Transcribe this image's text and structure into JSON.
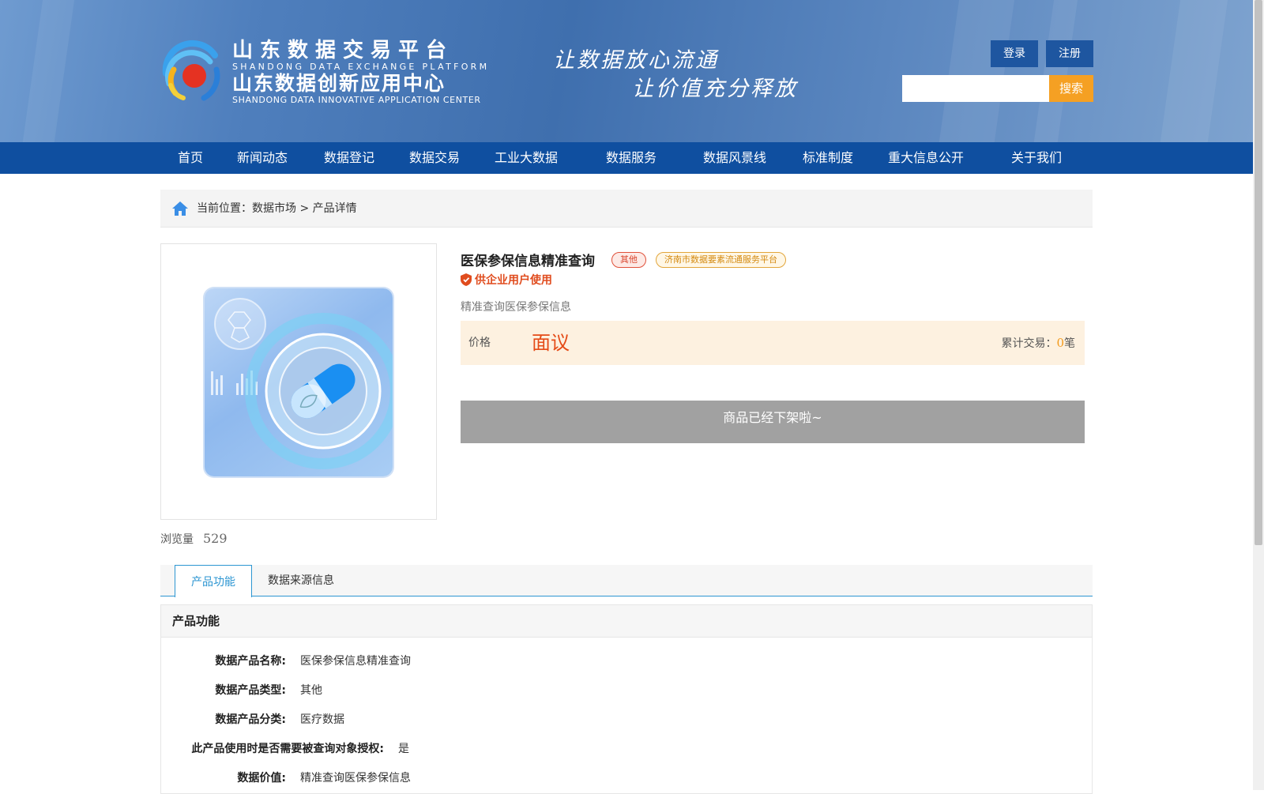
{
  "header": {
    "logo": {
      "title_cn": "山东数据交易平台",
      "title_en": "SHANDONG DATA EXCHANGE PLATFORM",
      "subtitle_cn": "山东数据创新应用中心",
      "subtitle_en": "SHANDONG DATA INNOVATIVE APPLICATION CENTER"
    },
    "slogan": [
      "让数据放心流通",
      "让价值充分释放"
    ],
    "login_label": "登录",
    "register_label": "注册",
    "search": {
      "placeholder": "",
      "button_label": "搜索"
    }
  },
  "nav": {
    "items": [
      "首页",
      "新闻动态",
      "数据登记",
      "数据交易",
      "工业大数据",
      "数据服务",
      "数据风景线",
      "标准制度",
      "重大信息公开",
      "关于我们"
    ]
  },
  "breadcrumb": {
    "prefix": "当前位置：",
    "path": "数据市场 > 产品详情"
  },
  "product": {
    "title": "医保参保信息精准查询",
    "tags": [
      "其他",
      "济南市数据要素流通服务平台"
    ],
    "audience": "供企业用户使用",
    "description": "精准查询医保参保信息",
    "price_label": "价格",
    "price_value": "面议",
    "trade_label": "累计交易：",
    "trade_count": "0",
    "trade_unit": "笔",
    "status": "商品已经下架啦~",
    "views_label": "浏览量",
    "views": "529"
  },
  "tabs": [
    "产品功能",
    "数据来源信息"
  ],
  "details": {
    "heading": "产品功能",
    "rows": [
      {
        "label": "数据产品名称:",
        "value": "医保参保信息精准查询"
      },
      {
        "label": "数据产品类型:",
        "value": "其他"
      },
      {
        "label": "数据产品分类:",
        "value": "医疗数据"
      },
      {
        "label": "此产品使用时是否需要被查询对象授权:",
        "value": "是"
      },
      {
        "label": "数据价值:",
        "value": "精准查询医保参保信息"
      }
    ]
  },
  "colors": {
    "nav_bg": "#0f4fa0",
    "search_button": "#f5a023",
    "accent_blue": "#2d96d2",
    "price_red": "#e54b17",
    "offshelf_gray": "#a1a1a1"
  }
}
